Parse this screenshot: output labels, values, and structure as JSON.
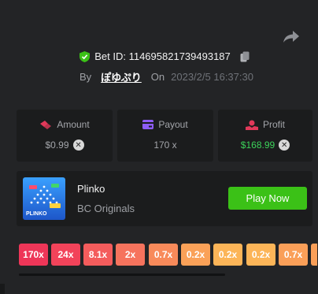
{
  "bet": {
    "id_text": "Bet ID: 114695821739493187",
    "by_label": "By",
    "username": "ぽゆぷり",
    "on_label": "On",
    "datetime": "2023/2/5 16:37:30"
  },
  "stats": {
    "amount": {
      "label": "Amount",
      "value": "$0.99"
    },
    "payout": {
      "label": "Payout",
      "value": "170 x"
    },
    "profit": {
      "label": "Profit",
      "value": "$168.99"
    }
  },
  "game": {
    "name": "Plinko",
    "provider": "BC Originals",
    "play_label": "Play Now",
    "thumb_text": "PLINKO"
  },
  "multipliers": [
    "170x",
    "24x",
    "8.1x",
    "2x",
    "0.7x",
    "0.2x",
    "0.2x",
    "0.2x",
    "0.7x"
  ],
  "colors": {
    "accent_green": "#3bc117",
    "profit_green": "#3cd25a",
    "mult_colors": [
      "#ee3658",
      "#f2435a",
      "#f45c5c",
      "#f6735d",
      "#f88a5a",
      "#faa158",
      "#fcb558",
      "#fcb558",
      "#fa9f58"
    ]
  }
}
